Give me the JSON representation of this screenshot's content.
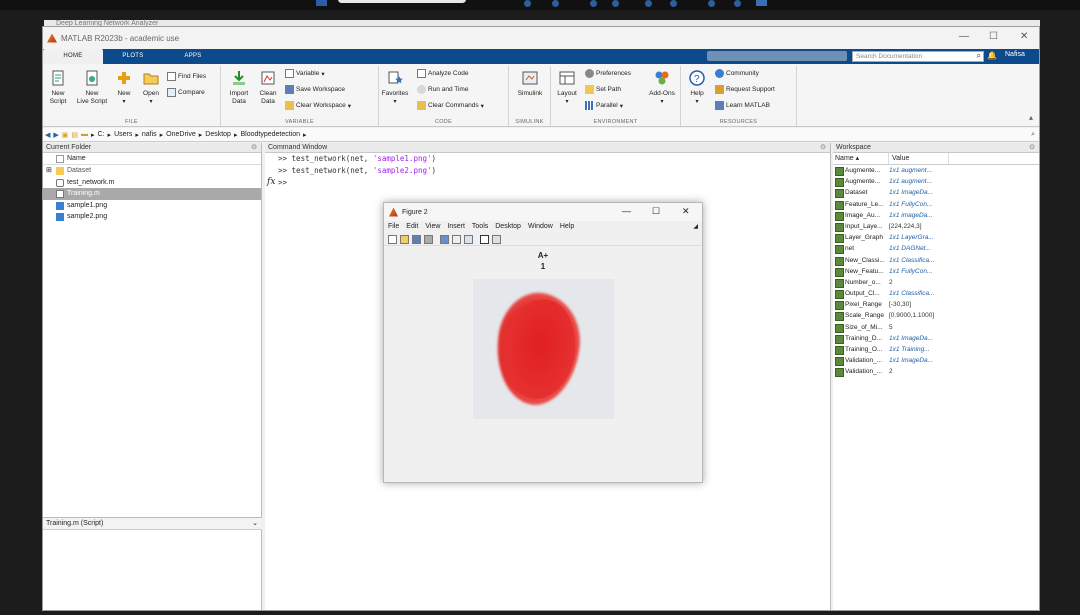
{
  "background_title": "Deep Learning Network Analyzer",
  "window": {
    "title": "MATLAB R2023b - academic use"
  },
  "ribbon": {
    "tabs": [
      "HOME",
      "PLOTS",
      "APPS"
    ],
    "search_placeholder": "Search Documentation",
    "user": "Nafisa",
    "file": {
      "label": "FILE",
      "new_script": "New\nScript",
      "new_live_script": "New\nLive Script",
      "new": "New",
      "open": "Open",
      "find_files": "Find Files",
      "compare": "Compare"
    },
    "variable": {
      "label": "VARIABLE",
      "import_data": "Import\nData",
      "clean_data": "Clean\nData",
      "variable": "Variable",
      "save_workspace": "Save Workspace",
      "clear_workspace": "Clear Workspace"
    },
    "code": {
      "label": "CODE",
      "favorites": "Favorites",
      "analyze_code": "Analyze Code",
      "run_and_time": "Run and Time",
      "clear_commands": "Clear Commands"
    },
    "simulink": {
      "label": "SIMULINK",
      "simulink": "Simulink"
    },
    "environment": {
      "label": "ENVIRONMENT",
      "layout": "Layout",
      "preferences": "Preferences",
      "set_path": "Set Path",
      "parallel": "Parallel",
      "add_ons": "Add-Ons"
    },
    "resources": {
      "label": "RESOURCES",
      "help": "Help",
      "community": "Community",
      "request_support": "Request Support",
      "learn_matlab": "Learn MATLAB"
    }
  },
  "address": {
    "path": [
      "C:",
      "Users",
      "nafis",
      "OneDrive",
      "Desktop",
      "Bloodtypedetection"
    ]
  },
  "current_folder": {
    "title": "Current Folder",
    "column": "Name",
    "items": [
      {
        "name": "Dataset",
        "type": "folder"
      },
      {
        "name": "test_network.m",
        "type": "function"
      },
      {
        "name": "Training.m",
        "type": "script",
        "selected": true
      },
      {
        "name": "sample1.png",
        "type": "image"
      },
      {
        "name": "sample2.png",
        "type": "image"
      }
    ],
    "details": "Training.m  (Script)"
  },
  "command_window": {
    "title": "Command Window",
    "lines": [
      {
        "prompt": ">>",
        "code": "test_network(net, ",
        "str": "'sample1.png'",
        "end": ")"
      },
      {
        "prompt": ">>",
        "code": "test_network(net, ",
        "str": "'sample2.png'",
        "end": ")"
      }
    ],
    "current_prompt": ">>",
    "fx": "fx"
  },
  "workspace": {
    "title": "Workspace",
    "col_name": "Name",
    "col_value": "Value",
    "variables": [
      {
        "name": "Augmente...",
        "value": "1x1 augment...",
        "plain": false
      },
      {
        "name": "Augmente...",
        "value": "1x1 augment...",
        "plain": false
      },
      {
        "name": "Dataset",
        "value": "1x1 ImageDa...",
        "plain": false
      },
      {
        "name": "Feature_Le...",
        "value": "1x1 FullyCon...",
        "plain": false
      },
      {
        "name": "Image_Au...",
        "value": "1x1 imageDa...",
        "plain": false
      },
      {
        "name": "Input_Laye...",
        "value": "[224,224,3]",
        "plain": true
      },
      {
        "name": "Layer_Graph",
        "value": "1x1 LayerGra...",
        "plain": false
      },
      {
        "name": "net",
        "value": "1x1 DAGNet...",
        "plain": false
      },
      {
        "name": "New_Classi...",
        "value": "1x1 Classifica...",
        "plain": false
      },
      {
        "name": "New_Featu...",
        "value": "1x1 FullyCon...",
        "plain": false
      },
      {
        "name": "Number_o...",
        "value": "2",
        "plain": true
      },
      {
        "name": "Output_Cl...",
        "value": "1x1 Classifica...",
        "plain": false
      },
      {
        "name": "Pixel_Range",
        "value": "[-30,30]",
        "plain": true
      },
      {
        "name": "Scale_Range",
        "value": "[0.9000,1.1000]",
        "plain": true
      },
      {
        "name": "Size_of_Mi...",
        "value": "5",
        "plain": true
      },
      {
        "name": "Training_D...",
        "value": "1x1 ImageDa...",
        "plain": false
      },
      {
        "name": "Training_O...",
        "value": "1x1 Training...",
        "plain": false
      },
      {
        "name": "Validation_...",
        "value": "1x1 ImageDa...",
        "plain": false
      },
      {
        "name": "Validation_...",
        "value": "2",
        "plain": true
      }
    ]
  },
  "figure": {
    "title": "Figure 2",
    "menu": [
      "File",
      "Edit",
      "View",
      "Insert",
      "Tools",
      "Desktop",
      "Window",
      "Help"
    ],
    "image_title": "A+",
    "image_subtitle": "1"
  }
}
